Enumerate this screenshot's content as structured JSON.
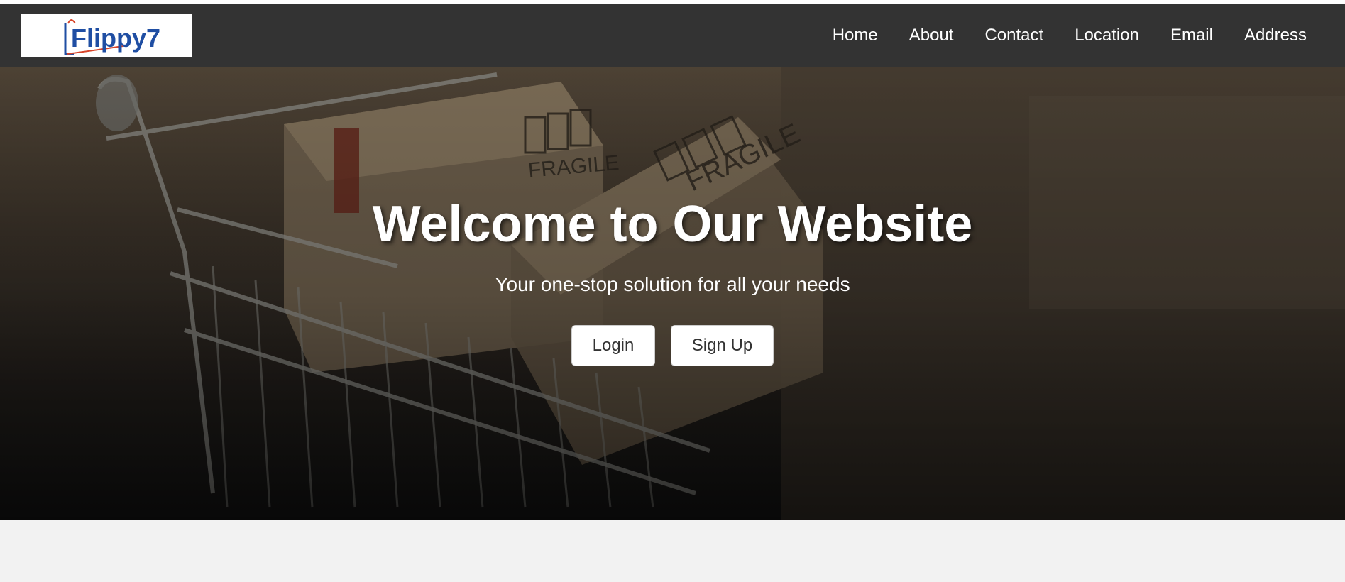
{
  "brand": {
    "logo_text": "Flippy7",
    "colors": {
      "navbar_bg": "#333333",
      "logo_blue": "#1f4ea3",
      "logo_red": "#d8452a",
      "page_bg": "#f2f2f2"
    }
  },
  "nav": {
    "items": [
      {
        "label": "Home"
      },
      {
        "label": "About"
      },
      {
        "label": "Contact"
      },
      {
        "label": "Location"
      },
      {
        "label": "Email"
      },
      {
        "label": "Address"
      }
    ]
  },
  "hero": {
    "title": "Welcome to Our Website",
    "subtitle": "Your one-stop solution for all your needs",
    "buttons": {
      "login_label": "Login",
      "signup_label": "Sign Up"
    },
    "background_image": "shopping-cart-with-fragile-boxes"
  }
}
